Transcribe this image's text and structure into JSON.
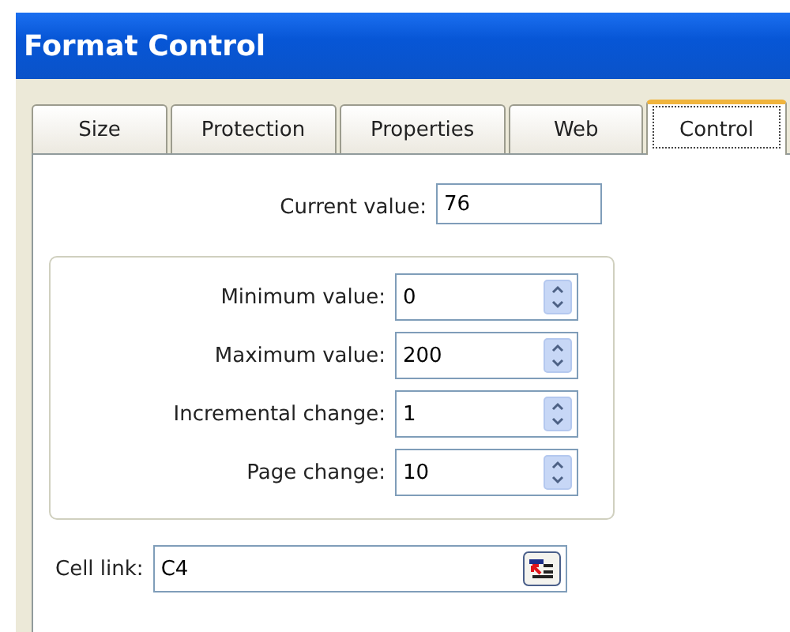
{
  "window": {
    "title": "Format Control"
  },
  "tabs": [
    {
      "label": "Size",
      "selected": false
    },
    {
      "label": "Protection",
      "selected": false
    },
    {
      "label": "Properties",
      "selected": false
    },
    {
      "label": "Web",
      "selected": false
    },
    {
      "label": "Control",
      "selected": true
    }
  ],
  "current_value": {
    "label": "Current value:",
    "value": "76"
  },
  "spin_fields": [
    {
      "label": "Minimum value:",
      "value": "0"
    },
    {
      "label": "Maximum value:",
      "value": "200"
    },
    {
      "label": "Incremental change:",
      "value": "1"
    },
    {
      "label": "Page change:",
      "value": "10"
    }
  ],
  "cell_link": {
    "label": "Cell link:",
    "value": "C4"
  }
}
